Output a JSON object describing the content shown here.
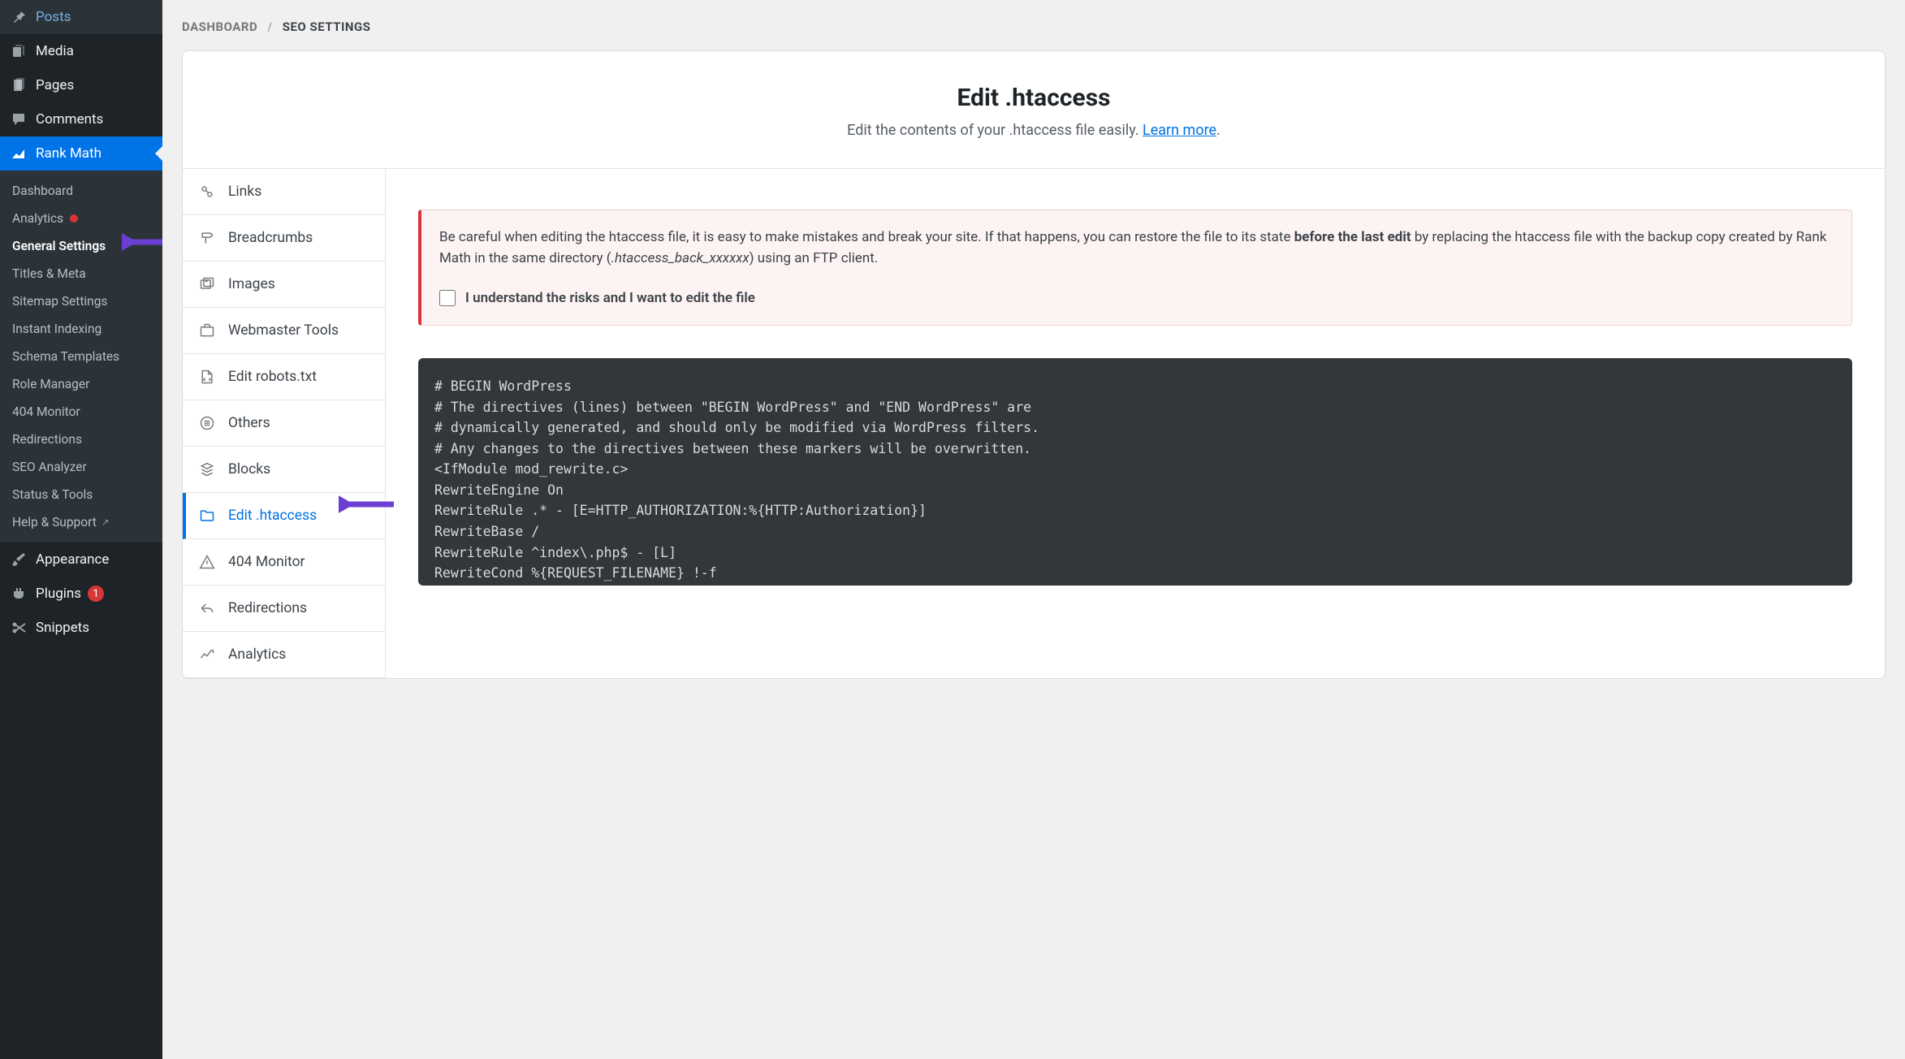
{
  "sidebar": {
    "items": [
      {
        "id": "posts",
        "label": "Posts",
        "icon": "pin"
      },
      {
        "id": "media",
        "label": "Media",
        "icon": "media"
      },
      {
        "id": "pages",
        "label": "Pages",
        "icon": "pages"
      },
      {
        "id": "comments",
        "label": "Comments",
        "icon": "comment"
      },
      {
        "id": "rankmath",
        "label": "Rank Math",
        "icon": "chart",
        "active": true
      },
      {
        "id": "appearance",
        "label": "Appearance",
        "icon": "brush"
      },
      {
        "id": "plugins",
        "label": "Plugins",
        "icon": "plug",
        "badge": "1"
      },
      {
        "id": "snippets",
        "label": "Snippets",
        "icon": "scissors"
      }
    ],
    "submenu": [
      {
        "label": "Dashboard"
      },
      {
        "label": "Analytics",
        "dot": true
      },
      {
        "label": "General Settings",
        "current": true
      },
      {
        "label": "Titles & Meta"
      },
      {
        "label": "Sitemap Settings"
      },
      {
        "label": "Instant Indexing"
      },
      {
        "label": "Schema Templates"
      },
      {
        "label": "Role Manager"
      },
      {
        "label": "404 Monitor"
      },
      {
        "label": "Redirections"
      },
      {
        "label": "SEO Analyzer"
      },
      {
        "label": "Status & Tools"
      },
      {
        "label": "Help & Support",
        "external": true
      }
    ]
  },
  "breadcrumb": {
    "root": "DASHBOARD",
    "sep": "/",
    "current": "SEO SETTINGS"
  },
  "header": {
    "title": "Edit .htaccess",
    "subtitle_prefix": "Edit the contents of your .htaccess file easily. ",
    "learn_more": "Learn more",
    "subtitle_suffix": "."
  },
  "tabs": [
    {
      "id": "links",
      "label": "Links",
      "icon": "link"
    },
    {
      "id": "breadcrumbs",
      "label": "Breadcrumbs",
      "icon": "sign"
    },
    {
      "id": "images",
      "label": "Images",
      "icon": "images"
    },
    {
      "id": "webmaster",
      "label": "Webmaster Tools",
      "icon": "briefcase"
    },
    {
      "id": "robots",
      "label": "Edit robots.txt",
      "icon": "filecode"
    },
    {
      "id": "others",
      "label": "Others",
      "icon": "list"
    },
    {
      "id": "blocks",
      "label": "Blocks",
      "icon": "blocks"
    },
    {
      "id": "htaccess",
      "label": "Edit .htaccess",
      "icon": "folder",
      "active": true
    },
    {
      "id": "404",
      "label": "404 Monitor",
      "icon": "warning"
    },
    {
      "id": "redirections",
      "label": "Redirections",
      "icon": "redirect"
    },
    {
      "id": "analytics",
      "label": "Analytics",
      "icon": "analytics"
    }
  ],
  "warning": {
    "text1": "Be careful when editing the htaccess file, it is easy to make mistakes and break your site. If that happens, you can restore the file to its state ",
    "bold": "before the last edit",
    "text2": " by replacing the htaccess file with the backup copy created by Rank Math in the same directory (",
    "italic": ".htaccess_back_xxxxxx",
    "text3": ") using an FTP client.",
    "checkbox_label": "I understand the risks and I want to edit the file"
  },
  "code": "# BEGIN WordPress\n# The directives (lines) between \"BEGIN WordPress\" and \"END WordPress\" are\n# dynamically generated, and should only be modified via WordPress filters.\n# Any changes to the directives between these markers will be overwritten.\n<IfModule mod_rewrite.c>\nRewriteEngine On\nRewriteRule .* - [E=HTTP_AUTHORIZATION:%{HTTP:Authorization}]\nRewriteBase /\nRewriteRule ^index\\.php$ - [L]\nRewriteCond %{REQUEST_FILENAME} !-f\nRewriteCond %{REQUEST_FILENAME} !-d"
}
